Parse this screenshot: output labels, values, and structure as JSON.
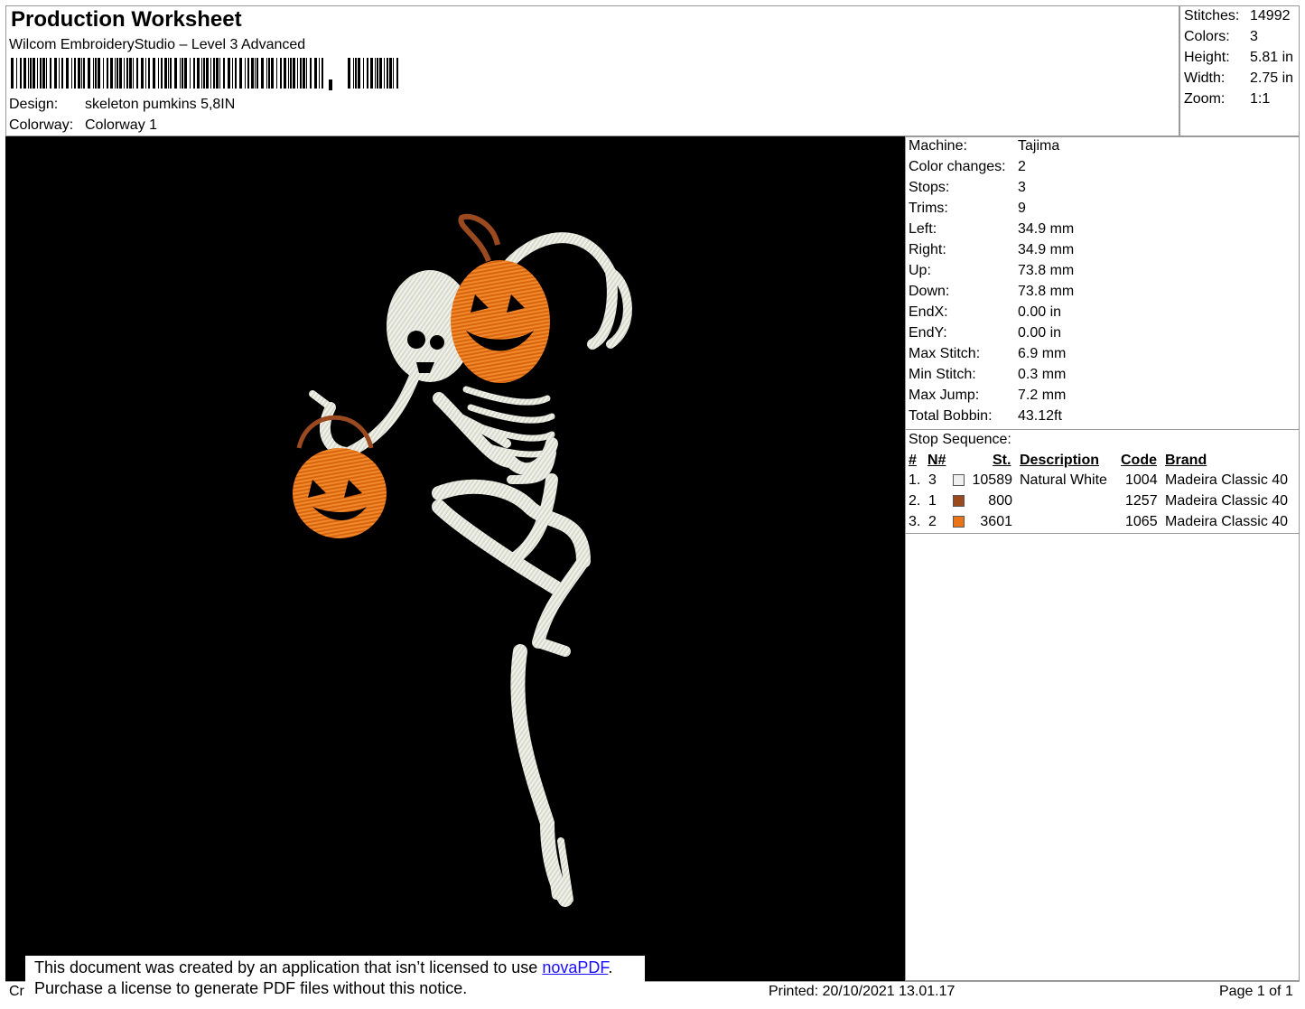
{
  "header": {
    "title": "Production Worksheet",
    "subtitle": "Wilcom EmbroideryStudio – Level 3 Advanced",
    "design_label": "Design:",
    "design_value": "skeleton pumkins 5,8IN",
    "colorway_label": "Colorway:",
    "colorway_value": "Colorway 1"
  },
  "summary": [
    {
      "label": "Stitches:",
      "value": "14992"
    },
    {
      "label": "Colors:",
      "value": "3"
    },
    {
      "label": "Height:",
      "value": "5.81 in"
    },
    {
      "label": "Width:",
      "value": "2.75 in"
    },
    {
      "label": "Zoom:",
      "value": "1:1"
    }
  ],
  "machine": [
    {
      "label": "Machine:",
      "value": "Tajima"
    },
    {
      "label": "Color changes:",
      "value": "2"
    },
    {
      "label": "Stops:",
      "value": "3"
    },
    {
      "label": "Trims:",
      "value": "9"
    },
    {
      "label": "Left:",
      "value": "34.9 mm"
    },
    {
      "label": "Right:",
      "value": "34.9 mm"
    },
    {
      "label": "Up:",
      "value": "73.8 mm"
    },
    {
      "label": "Down:",
      "value": "73.8 mm"
    },
    {
      "label": "EndX:",
      "value": "0.00 in"
    },
    {
      "label": "EndY:",
      "value": "0.00 in"
    },
    {
      "label": "Max Stitch:",
      "value": "6.9 mm"
    },
    {
      "label": "Min Stitch:",
      "value": "0.3 mm"
    },
    {
      "label": "Max Jump:",
      "value": "7.2 mm"
    },
    {
      "label": "Total Bobbin:",
      "value": "43.12ft"
    }
  ],
  "stop_sequence": {
    "title": "Stop Sequence:",
    "headers": {
      "num": "#",
      "needle": "N#",
      "stitches": "St.",
      "description": "Description",
      "code": "Code",
      "brand": "Brand"
    },
    "rows": [
      {
        "num": "1.",
        "needle": "3",
        "swatch_color": "#efefef",
        "stitches": "10589",
        "description": "Natural White",
        "code": "1004",
        "brand": "Madeira Classic 40"
      },
      {
        "num": "2.",
        "needle": "1",
        "swatch_color": "#9a4a1e",
        "stitches": "800",
        "description": "",
        "code": "1257",
        "brand": "Madeira Classic 40"
      },
      {
        "num": "3.",
        "needle": "2",
        "swatch_color": "#ec7418",
        "stitches": "3601",
        "description": "",
        "code": "1065",
        "brand": "Madeira Classic 40"
      }
    ]
  },
  "colors": {
    "canvas_bg": "#000000",
    "thread_white": "#e6e8dc",
    "thread_brown": "#9a4a1e",
    "thread_orange": "#ec7418"
  },
  "footer": {
    "partial_text": "Cr",
    "printed": "Printed: 20/10/2021 13.01.17",
    "page": "Page 1 of 1"
  },
  "notice": {
    "line1": "This document was created by an application that isn’t licensed to use ",
    "link": "novaPDF",
    "line1_end": ".",
    "line2": "Purchase a license to generate PDF files without this notice."
  }
}
